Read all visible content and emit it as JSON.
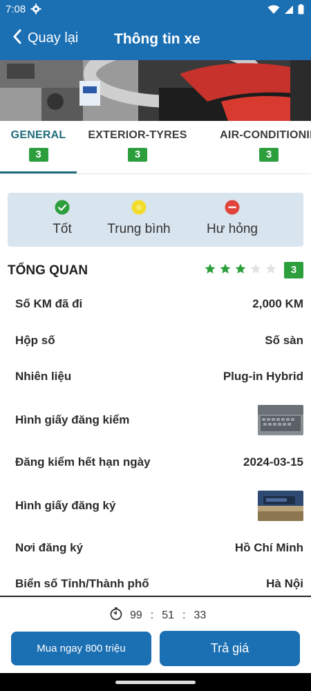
{
  "status_bar": {
    "time": "7:08"
  },
  "header": {
    "back_label": "Quay lại",
    "title": "Thông tin xe"
  },
  "tabs": [
    {
      "label": "GENERAL",
      "count": "3",
      "active": true
    },
    {
      "label": "EXTERIOR-TYRES",
      "count": "3",
      "active": false
    },
    {
      "label": "AIR-CONDITIONIN",
      "count": "3",
      "active": false
    }
  ],
  "legend": [
    {
      "label": "Tốt",
      "icon": "check-circle-icon",
      "color": "#2c9e3c"
    },
    {
      "label": "Trung bình",
      "icon": "dot-circle-icon",
      "color": "#f2dc2a"
    },
    {
      "label": "Hư hỏng",
      "icon": "minus-circle-icon",
      "color": "#e0443a"
    }
  ],
  "section": {
    "title": "TỔNG QUAN",
    "rating": 3,
    "rating_max": 5,
    "rating_badge": "3"
  },
  "rows": [
    {
      "label": "Số KM đã đi",
      "value": "2,000 KM"
    },
    {
      "label": "Hộp số",
      "value": "Số sàn"
    },
    {
      "label": "Nhiên liệu",
      "value": "Plug-in Hybrid"
    },
    {
      "label": "Hình giấy đăng kiểm",
      "value": ""
    },
    {
      "label": "Đăng kiểm hết hạn ngày",
      "value": "2024-03-15"
    },
    {
      "label": "Hình giấy đăng ký",
      "value": ""
    },
    {
      "label": "Nơi đăng ký",
      "value": "Hồ Chí Minh"
    },
    {
      "label": "Biển số Tỉnh/Thành phố",
      "value": "Hà Nội"
    }
  ],
  "timer": {
    "hours": "99",
    "minutes": "51",
    "seconds": "33",
    "separator": ":"
  },
  "buttons": {
    "buy": "Mua ngay 800 triệu",
    "bid": "Trả giá"
  },
  "colors": {
    "primary": "#1b6fb3",
    "badge_green": "#2c9e3c",
    "legend_bg": "#d8e4ee",
    "tab_active": "#1f6c7b"
  }
}
